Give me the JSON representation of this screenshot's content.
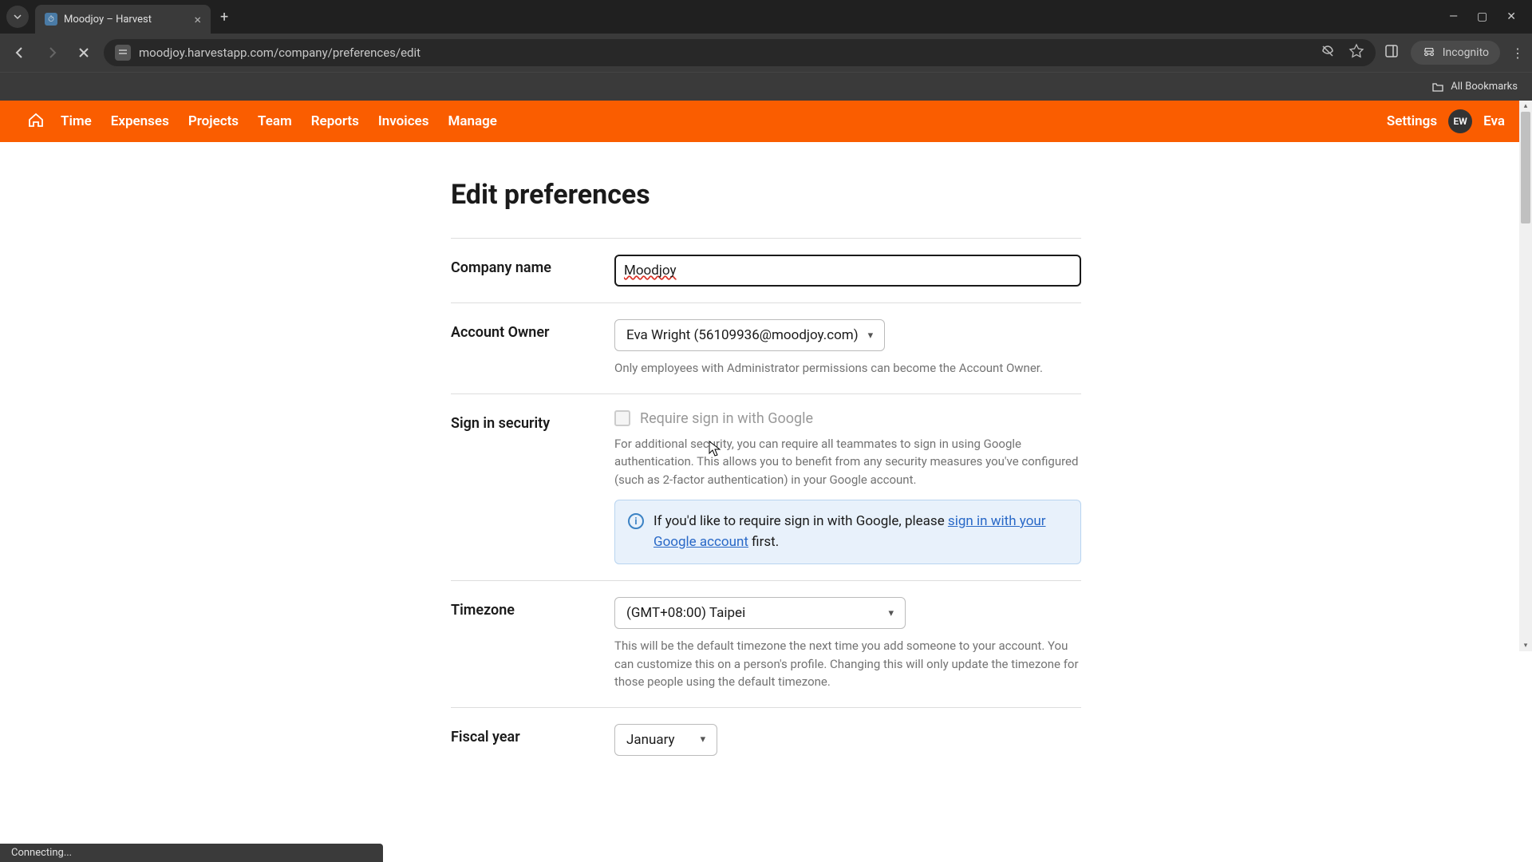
{
  "browser": {
    "tab_title": "Moodjoy – Harvest",
    "url": "moodjoy.harvestapp.com/company/preferences/edit",
    "incognito_label": "Incognito",
    "bookmarks_label": "All Bookmarks",
    "status_text": "Connecting..."
  },
  "nav": {
    "items": [
      "Time",
      "Expenses",
      "Projects",
      "Team",
      "Reports",
      "Invoices",
      "Manage"
    ],
    "settings": "Settings",
    "avatar_initials": "EW",
    "user_name": "Eva"
  },
  "page": {
    "title": "Edit preferences"
  },
  "form": {
    "company_name": {
      "label": "Company name",
      "value": "Moodjoy"
    },
    "account_owner": {
      "label": "Account Owner",
      "value": "Eva Wright (56109936@moodjoy.com)",
      "help": "Only employees with Administrator permissions can become the Account Owner."
    },
    "signin": {
      "label": "Sign in security",
      "checkbox_label": "Require sign in with Google",
      "help": "For additional security, you can require all teammates to sign in using Google authentication. This allows you to benefit from any security measures you've configured (such as 2-factor authentication) in your Google account.",
      "info_prefix": "If you'd like to require sign in with Google, please ",
      "info_link": "sign in with your Google account",
      "info_suffix": " first."
    },
    "timezone": {
      "label": "Timezone",
      "value": "(GMT+08:00) Taipei",
      "help": "This will be the default timezone the next time you add someone to your account. You can customize this on a person's profile. Changing this will only update the timezone for those people using the default timezone."
    },
    "fiscal_year": {
      "label": "Fiscal year",
      "value": "January"
    }
  }
}
